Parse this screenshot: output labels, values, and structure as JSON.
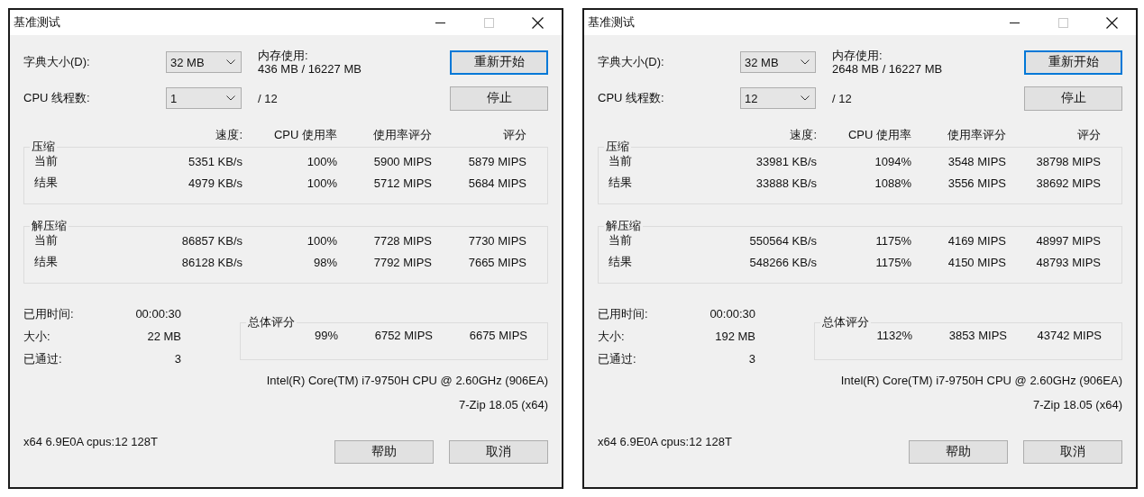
{
  "windows": [
    {
      "title": "基准测试",
      "controls": [
        {
          "kind": "minimize",
          "disabled": false
        },
        {
          "kind": "maximize",
          "disabled": true
        },
        {
          "kind": "close",
          "disabled": false
        }
      ],
      "dictionary": {
        "label": "字典大小(D):",
        "value": "32 MB"
      },
      "threads": {
        "label": "CPU 线程数:",
        "value": "1",
        "max": "/ 12"
      },
      "memory": {
        "label": "内存使用:",
        "value": "436 MB / 16227 MB"
      },
      "buttons": [
        {
          "label": "重新开始",
          "focused": true
        },
        {
          "label": "停止",
          "focused": false
        }
      ],
      "headers": [
        "速度:",
        "CPU 使用率",
        "使用率评分",
        "评分"
      ],
      "groups": [
        {
          "title": "压缩",
          "rows": [
            {
              "label": "当前",
              "speed": "5351 KB/s",
              "cpu": "100%",
              "usage_rating": "5900 MIPS",
              "rating": "5879 MIPS"
            },
            {
              "label": "结果",
              "speed": "4979 KB/s",
              "cpu": "100%",
              "usage_rating": "5712 MIPS",
              "rating": "5684 MIPS"
            }
          ]
        },
        {
          "title": "解压缩",
          "rows": [
            {
              "label": "当前",
              "speed": "86857 KB/s",
              "cpu": "100%",
              "usage_rating": "7728 MIPS",
              "rating": "7730 MIPS"
            },
            {
              "label": "结果",
              "speed": "86128 KB/s",
              "cpu": "98%",
              "usage_rating": "7792 MIPS",
              "rating": "7665 MIPS"
            }
          ]
        }
      ],
      "stats": [
        {
          "label": "已用时间:",
          "value": "00:00:30"
        },
        {
          "label": "大小:",
          "value": "22 MB"
        },
        {
          "label": "已通过:",
          "value": "3"
        }
      ],
      "total": {
        "title": "总体评分",
        "cpu": "99%",
        "usage_rating": "6752 MIPS",
        "rating": "6675 MIPS"
      },
      "cpu_info": "Intel(R) Core(TM) i7-9750H CPU @ 2.60GHz (906EA)",
      "version": "7-Zip 18.05 (x64)",
      "footer": "x64 6.9E0A cpus:12 128T",
      "bottom_buttons": [
        "帮助",
        "取消"
      ]
    },
    {
      "title": "基准测试",
      "controls": [
        {
          "kind": "minimize",
          "disabled": false
        },
        {
          "kind": "maximize",
          "disabled": true
        },
        {
          "kind": "close",
          "disabled": false
        }
      ],
      "dictionary": {
        "label": "字典大小(D):",
        "value": "32 MB"
      },
      "threads": {
        "label": "CPU 线程数:",
        "value": "12",
        "max": "/ 12"
      },
      "memory": {
        "label": "内存使用:",
        "value": "2648 MB / 16227 MB"
      },
      "buttons": [
        {
          "label": "重新开始",
          "focused": true
        },
        {
          "label": "停止",
          "focused": false
        }
      ],
      "headers": [
        "速度:",
        "CPU 使用率",
        "使用率评分",
        "评分"
      ],
      "groups": [
        {
          "title": "压缩",
          "rows": [
            {
              "label": "当前",
              "speed": "33981 KB/s",
              "cpu": "1094%",
              "usage_rating": "3548 MIPS",
              "rating": "38798 MIPS"
            },
            {
              "label": "结果",
              "speed": "33888 KB/s",
              "cpu": "1088%",
              "usage_rating": "3556 MIPS",
              "rating": "38692 MIPS"
            }
          ]
        },
        {
          "title": "解压缩",
          "rows": [
            {
              "label": "当前",
              "speed": "550564 KB/s",
              "cpu": "1175%",
              "usage_rating": "4169 MIPS",
              "rating": "48997 MIPS"
            },
            {
              "label": "结果",
              "speed": "548266 KB/s",
              "cpu": "1175%",
              "usage_rating": "4150 MIPS",
              "rating": "48793 MIPS"
            }
          ]
        }
      ],
      "stats": [
        {
          "label": "已用时间:",
          "value": "00:00:30"
        },
        {
          "label": "大小:",
          "value": "192 MB"
        },
        {
          "label": "已通过:",
          "value": "3"
        }
      ],
      "total": {
        "title": "总体评分",
        "cpu": "1132%",
        "usage_rating": "3853 MIPS",
        "rating": "43742 MIPS"
      },
      "cpu_info": "Intel(R) Core(TM) i7-9750H CPU @ 2.60GHz (906EA)",
      "version": "7-Zip 18.05 (x64)",
      "footer": "x64 6.9E0A cpus:12 128T",
      "bottom_buttons": [
        "帮助",
        "取消"
      ]
    }
  ]
}
